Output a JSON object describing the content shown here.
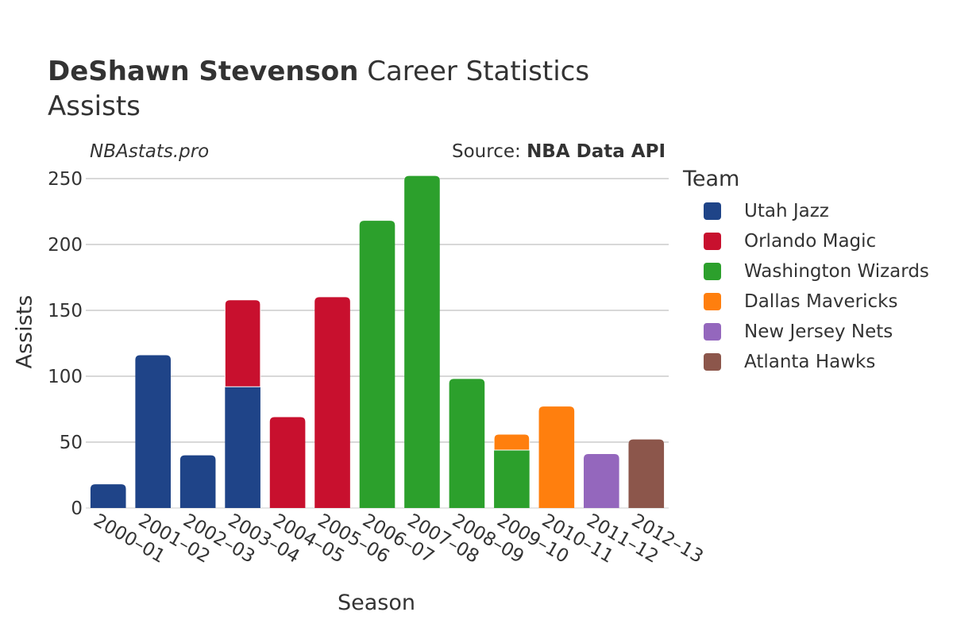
{
  "header": {
    "player_name": "DeShawn Stevenson",
    "title_suffix": "Career Statistics",
    "subtitle": "Assists",
    "site": "NBAstats.pro",
    "source_label": "Source:",
    "source_name": "NBA Data API"
  },
  "chart_data": {
    "type": "bar",
    "stacked": true,
    "title": "DeShawn Stevenson Career Statistics — Assists",
    "xlabel": "Season",
    "ylabel": "Assists",
    "ylim": [
      0,
      260
    ],
    "yticks": [
      0,
      50,
      100,
      150,
      200,
      250
    ],
    "grid": true,
    "legend_title": "Team",
    "legend_position": "right",
    "categories": [
      "2000–01",
      "2001–02",
      "2002–03",
      "2003–04",
      "2004–05",
      "2005–06",
      "2006–07",
      "2007–08",
      "2008–09",
      "2009–10",
      "2010–11",
      "2011–12",
      "2012–13"
    ],
    "series": [
      {
        "name": "Utah Jazz",
        "color": "#1f4488",
        "values": [
          18,
          116,
          40,
          92,
          0,
          0,
          0,
          0,
          0,
          0,
          0,
          0,
          0
        ]
      },
      {
        "name": "Orlando Magic",
        "color": "#c8102e",
        "values": [
          0,
          0,
          0,
          66,
          69,
          160,
          0,
          0,
          0,
          0,
          0,
          0,
          0
        ]
      },
      {
        "name": "Washington Wizards",
        "color": "#2ca02c",
        "values": [
          0,
          0,
          0,
          0,
          0,
          0,
          218,
          252,
          98,
          44,
          0,
          0,
          0
        ]
      },
      {
        "name": "Dallas Mavericks",
        "color": "#ff7f0e",
        "values": [
          0,
          0,
          0,
          0,
          0,
          0,
          0,
          0,
          0,
          12,
          77,
          0,
          0
        ]
      },
      {
        "name": "New Jersey Nets",
        "color": "#9467bd",
        "values": [
          0,
          0,
          0,
          0,
          0,
          0,
          0,
          0,
          0,
          0,
          0,
          41,
          0
        ]
      },
      {
        "name": "Atlanta Hawks",
        "color": "#8c564b",
        "values": [
          0,
          0,
          0,
          0,
          0,
          0,
          0,
          0,
          0,
          0,
          0,
          0,
          52
        ]
      }
    ]
  }
}
